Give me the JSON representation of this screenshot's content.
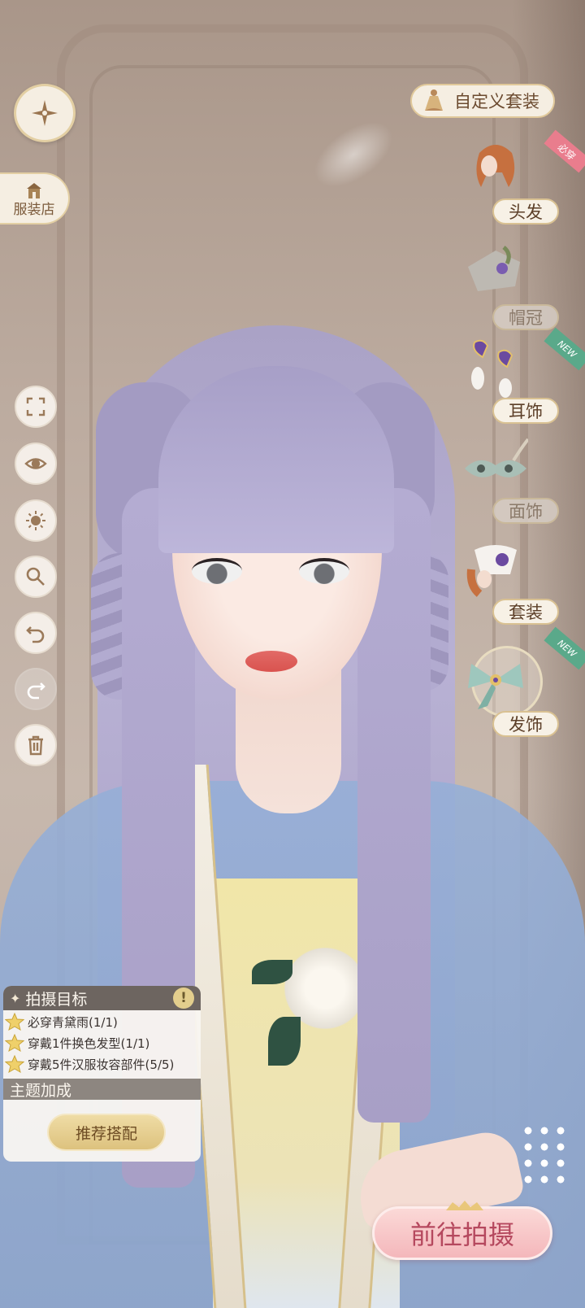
{
  "top_left": {
    "back_icon": "compass-star-icon",
    "shop_label": "服装店"
  },
  "left_toolbar": {
    "items": [
      {
        "icon": "fullscreen-icon"
      },
      {
        "icon": "eye-icon"
      },
      {
        "icon": "brightness-icon"
      },
      {
        "icon": "zoom-icon"
      },
      {
        "icon": "undo-icon"
      },
      {
        "icon": "redo-icon",
        "disabled": true
      },
      {
        "icon": "trash-icon"
      }
    ]
  },
  "custom_outfit": {
    "label": "自定义套装"
  },
  "categories": [
    {
      "label": "头发",
      "badge": "必穿"
    },
    {
      "label": "帽冠",
      "state": "locked"
    },
    {
      "label": "耳饰",
      "badge": "NEW"
    },
    {
      "label": "面饰",
      "state": "locked"
    },
    {
      "label": "套装"
    },
    {
      "label": "发饰",
      "badge": "NEW",
      "state": "selected"
    }
  ],
  "objective": {
    "title": "拍摄目标",
    "tasks": [
      {
        "text": "必穿青黛雨(1/1)"
      },
      {
        "text": "穿戴1件换色发型(1/1)"
      },
      {
        "text": "穿戴5件汉服妆容部件(5/5)"
      }
    ],
    "bonus_title": "主题加成",
    "recommend_label": "推荐搭配"
  },
  "shoot_button": {
    "label": "前往拍摄"
  },
  "colors": {
    "accent_gold": "#e0c89a",
    "shoot_pink": "#f4b7bb",
    "shoot_text": "#b5485e",
    "panel_header": "#6d6560"
  }
}
